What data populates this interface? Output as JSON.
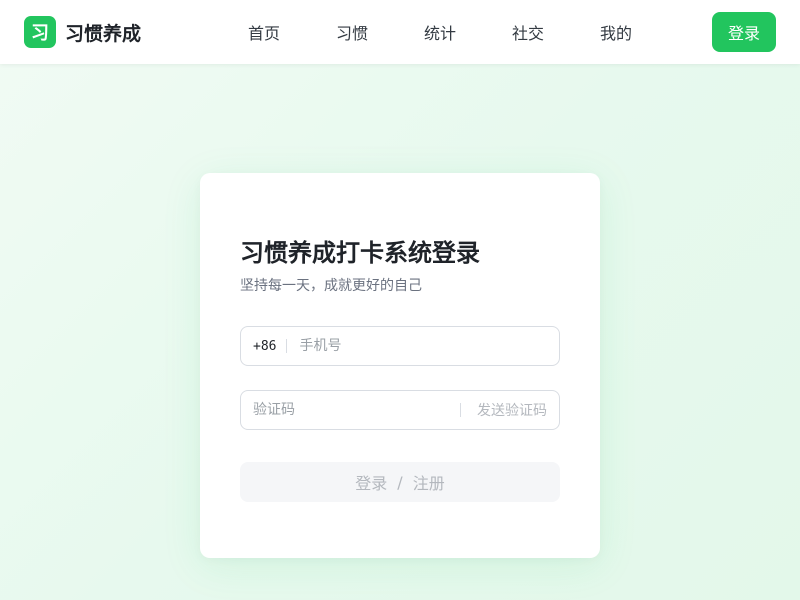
{
  "brand": {
    "logo_char": "习",
    "name": "习惯养成"
  },
  "nav": {
    "items": [
      {
        "label": "首页"
      },
      {
        "label": "习惯"
      },
      {
        "label": "统计"
      },
      {
        "label": "社交"
      },
      {
        "label": "我的"
      }
    ],
    "login_label": "登录"
  },
  "login_card": {
    "title": "习惯养成打卡系统登录",
    "subtitle": "坚持每一天，成就更好的自己",
    "phone": {
      "country_code": "+86",
      "placeholder": "手机号",
      "value": ""
    },
    "code": {
      "placeholder": "验证码",
      "value": "",
      "send_label": "发送验证码"
    },
    "submit": {
      "login_label": "登录",
      "separator": "/",
      "register_label": "注册",
      "enabled": false
    }
  },
  "colors": {
    "accent": "#22c55e",
    "background": "#e7f9ee",
    "disabled_button": "#f5f6f8",
    "disabled_text": "#b4b8be"
  }
}
